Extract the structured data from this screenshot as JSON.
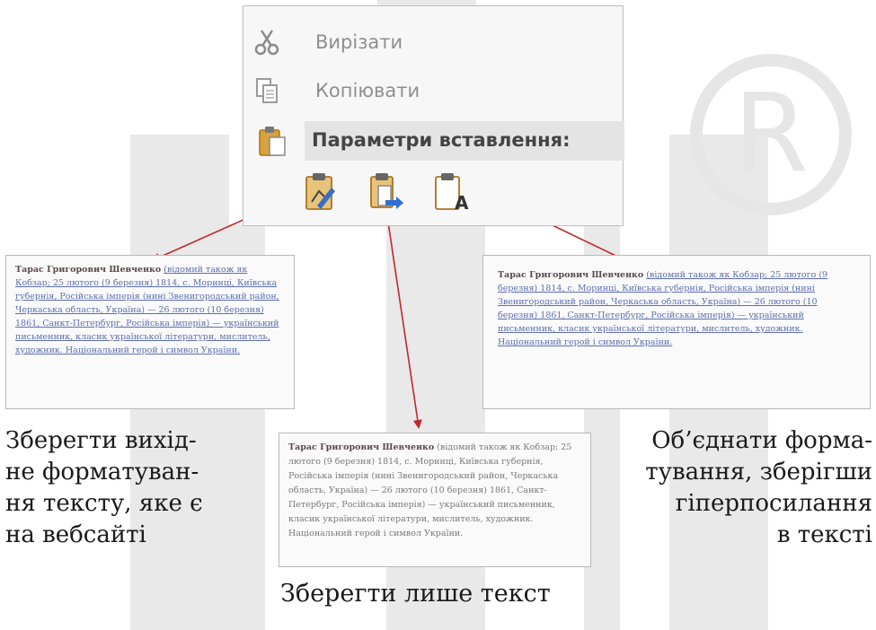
{
  "menu": {
    "items": [
      {
        "label": "Вирізати",
        "icon": "scissors-icon"
      },
      {
        "label": "Копіювати",
        "icon": "copy-icon"
      }
    ],
    "paste_header": "Параметри вставлення:",
    "paste_options": [
      {
        "icon": "paste-keep-formatting-icon"
      },
      {
        "icon": "paste-merge-formatting-icon"
      },
      {
        "icon": "paste-text-only-icon"
      }
    ]
  },
  "previews": {
    "left": {
      "name": "Тарас Григорович Шевченко",
      "text": "(відомий також як Кобзар; 25 лютого (9 березня) 1814, с. Моринці, Київська губернія, Російська імперія (нині Звенигородський район, Черкаська область, Україна) — 26 лютого (10 березня) 1861, Санкт-Петербург, Російська імперія) — український письменник, класик української літератури, мислитель, художник. Національний герой і символ України."
    },
    "middle": {
      "name": "Тарас Григорович Шевченко",
      "text": "(відомий також як Кобзар; 25 лютого (9 березня) 1814, с. Моринці, Київська губернія, Російська імперія (нині Звенигородський район, Черкаська область, Україна) — 26 лютого (10 березня) 1861, Санкт-Петербург, Російська імперія) — український письменник, класик української літератури, мислитель, художник. Національний герой і символ України."
    },
    "right": {
      "name": "Тарас Григорович Шевченко",
      "text": "(відомий також як Кобзар; 25 лютого (9 березня) 1814, с. Моринці, Київська губернія, Російська імперія (нині Звенигородський район, Черкаська область, Україна) — 26 лютого (10 березня) 1861, Санкт-Петербург, Російська імперія) — український письменник, класик української літератури, мислитель, художник. Національний герой і символ України."
    }
  },
  "captions": {
    "left": [
      "Зберегти вихід-",
      "не форматуван-",
      "ня тексту, яке є",
      "на вебсайті"
    ],
    "middle": "Зберегти лише текст",
    "right": [
      "Об’єднати форма-",
      "тування, зберігши",
      "гіперпосилання",
      "в тексті"
    ]
  },
  "colors": {
    "arrow": "#c0282d",
    "menu_text": "#8f8f8f",
    "header_bg": "#e4e4e4"
  }
}
